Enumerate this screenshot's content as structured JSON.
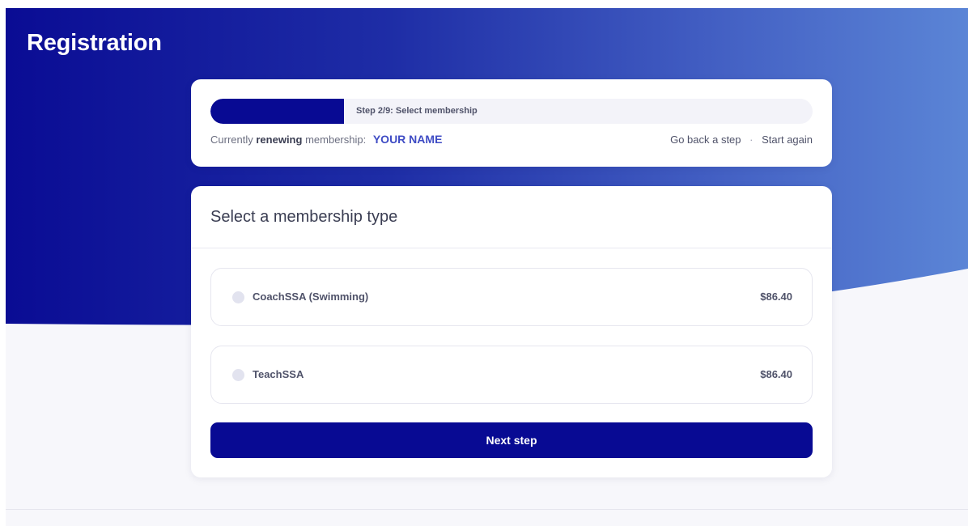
{
  "page": {
    "title": "Registration"
  },
  "progress": {
    "step_label": "Step 2/9: Select membership",
    "current_step": 2,
    "total_steps": 9,
    "status_prefix": "Currently",
    "status_action": "renewing",
    "status_suffix": "membership:",
    "member_name": "YOUR NAME",
    "go_back_label": "Go back a step",
    "separator": "·",
    "start_again_label": "Start again"
  },
  "membership": {
    "heading": "Select a membership type",
    "options": [
      {
        "label": "CoachSSA (Swimming)",
        "price": "$86.40",
        "selected": false
      },
      {
        "label": "TeachSSA",
        "price": "$86.40",
        "selected": false
      }
    ],
    "next_label": "Next step"
  },
  "colors": {
    "brand_dark": "#080a93",
    "brand_light": "#5b85d6",
    "accent_name": "#3e4bc4",
    "page_background": "#f7f7fb"
  }
}
